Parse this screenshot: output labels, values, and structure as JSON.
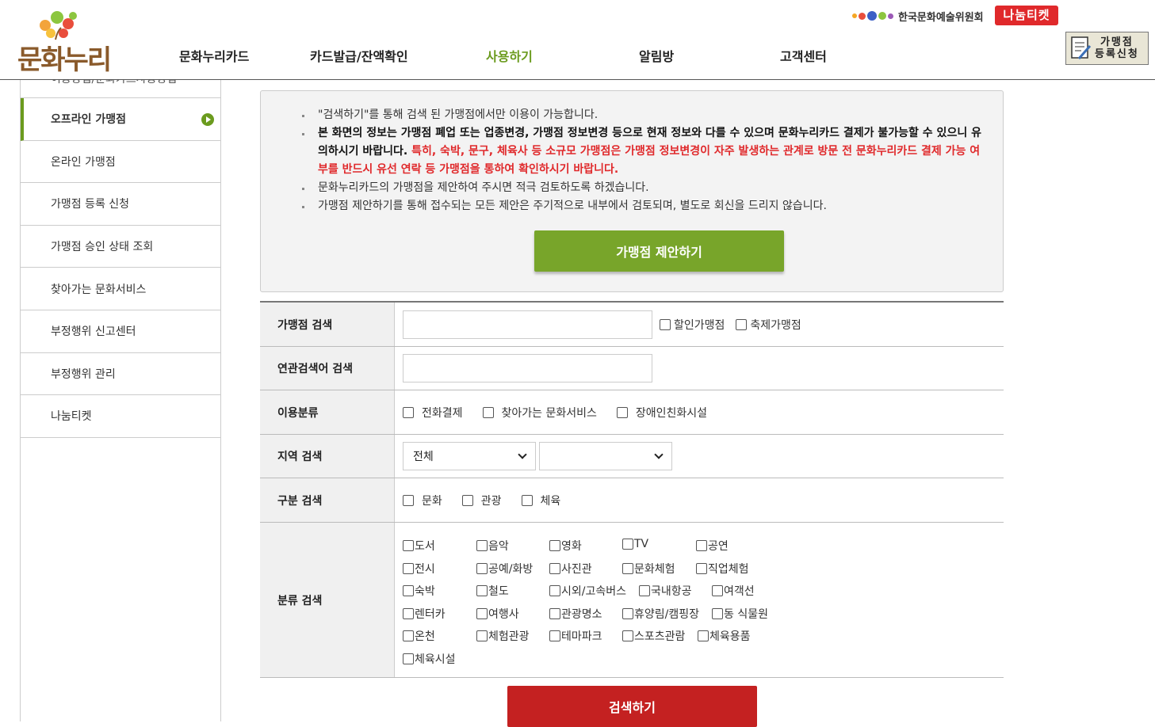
{
  "header": {
    "logo_text": "문화누리",
    "nav": [
      {
        "label": "문화누리카드",
        "active": false
      },
      {
        "label": "카드발급/잔액확인",
        "active": false
      },
      {
        "label": "사용하기",
        "active": true
      },
      {
        "label": "알림방",
        "active": false
      },
      {
        "label": "고객센터",
        "active": false
      }
    ],
    "org_name": "한국문화예술위원회",
    "ticket_logo": "나눔티켓",
    "register_line1": "가맹점",
    "register_line2": "등록신청"
  },
  "sidebar": {
    "cut_item": "이용방법/문화카드사용방법",
    "items": [
      {
        "label": "오프라인 가맹점",
        "active": true
      },
      {
        "label": "온라인 가맹점",
        "active": false
      },
      {
        "label": "가맹점 등록 신청",
        "active": false
      },
      {
        "label": "가맹점 승인 상태 조회",
        "active": false
      },
      {
        "label": "찾아가는 문화서비스",
        "active": false
      },
      {
        "label": "부정행위 신고센터",
        "active": false
      },
      {
        "label": "부정행위 관리",
        "active": false
      },
      {
        "label": "나눔티켓",
        "active": false
      }
    ]
  },
  "notice": {
    "line1": "\"검색하기\"를 통해 검색 된 가맹점에서만 이용이 가능합니다.",
    "line2_bold": "본 화면의 정보는 가맹점 폐업 또는 업종변경, 가맹점 정보변경 등으로 현재 정보와 다를 수 있으며 문화누리카드 결제가 불가능할 수 있으니 유의하시기 바랍니다.",
    "line2_red": " 특히, 숙박, 문구, 체육사 등 소규모 가맹점은 가맹점 정보변경이 자주 발생하는 관계로 방문 전 문화누리카드 결제 가능 여부를 반드시 유선 연락 등 가맹점을 통하여 확인하시기 바랍니다.",
    "line3": "문화누리카드의 가맹점을 제안하여 주시면 적극 검토하도록 하겠습니다.",
    "line4": "가맹점 제안하기를 통해 접수되는 모든 제안은 주기적으로 내부에서 검토되며, 별도로 회신을 드리지 않습니다.",
    "suggest_button": "가맹점 제안하기"
  },
  "search": {
    "store_label": "가맹점 검색",
    "store_value": "",
    "discount_label": "할인가맹점",
    "festival_label": "축제가맹점",
    "related_label": "연관검색어 검색",
    "related_value": "",
    "usage_label": "이용분류",
    "usage_options": [
      "전화결제",
      "찾아가는 문화서비스",
      "장애인친화시설"
    ],
    "region_label": "지역 검색",
    "region_selected": "전체",
    "region_sub_selected": "",
    "type_label": "구분 검색",
    "type_options": [
      "문화",
      "관광",
      "체육"
    ],
    "category_label": "분류 검색",
    "categories": [
      [
        "도서",
        "음악",
        "영화",
        "TV",
        "공연"
      ],
      [
        "전시",
        "공예/화방",
        "사진관",
        "문화체험",
        "직업체험"
      ],
      [
        "숙박",
        "철도",
        "시외/고속버스",
        "국내항공",
        "여객선"
      ],
      [
        "렌터카",
        "여행사",
        "관광명소",
        "휴양림/캠핑장",
        "동 식물원"
      ],
      [
        "온천",
        "체험관광",
        "테마파크",
        "스포츠관람",
        "체육용품"
      ],
      [
        "체육시설"
      ]
    ],
    "search_button": "검색하기"
  },
  "colors": {
    "accent_green": "#78a52a",
    "nav_active": "#6b9b1e",
    "notice_red": "#e0292b",
    "search_red": "#c42121"
  }
}
